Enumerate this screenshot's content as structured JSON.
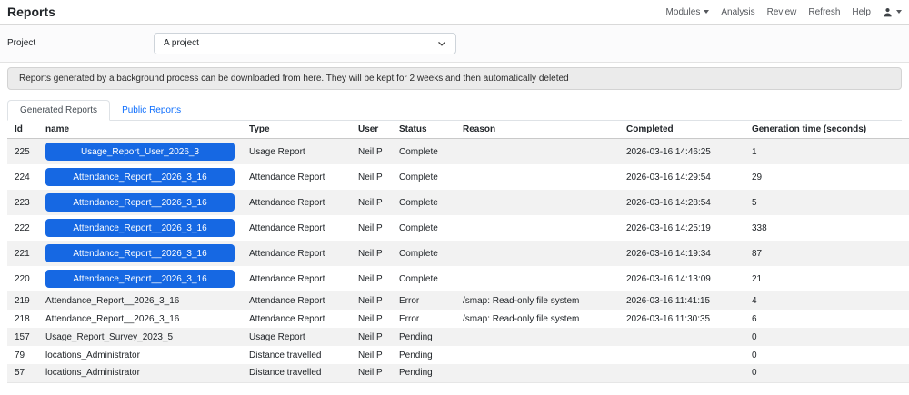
{
  "app": {
    "title": "Reports"
  },
  "nav": {
    "items": [
      {
        "label": "Modules",
        "caret": true
      },
      {
        "label": "Analysis",
        "caret": false
      },
      {
        "label": "Review",
        "caret": false
      },
      {
        "label": "Refresh",
        "caret": false
      },
      {
        "label": "Help",
        "caret": false
      }
    ],
    "user_icon": "person-icon"
  },
  "project": {
    "label": "Project",
    "selected": "A project"
  },
  "alert": {
    "text": "Reports generated by a background process can be downloaded from here. They will be kept for 2 weeks and then automatically deleted"
  },
  "tabs": [
    {
      "label": "Generated Reports",
      "active": true
    },
    {
      "label": "Public Reports",
      "active": false
    }
  ],
  "table": {
    "columns": [
      "Id",
      "name",
      "Type",
      "User",
      "Status",
      "Reason",
      "Completed",
      "Generation time (seconds)"
    ],
    "rows": [
      {
        "id": "225",
        "name": "Usage_Report_User_2026_3",
        "button": true,
        "type": "Usage Report",
        "user": "Neil P",
        "status": "Complete",
        "reason": "",
        "completed": "2026-03-16 14:46:25",
        "gen_time": "1"
      },
      {
        "id": "224",
        "name": "Attendance_Report__2026_3_16",
        "button": true,
        "type": "Attendance Report",
        "user": "Neil P",
        "status": "Complete",
        "reason": "",
        "completed": "2026-03-16 14:29:54",
        "gen_time": "29"
      },
      {
        "id": "223",
        "name": "Attendance_Report__2026_3_16",
        "button": true,
        "type": "Attendance Report",
        "user": "Neil P",
        "status": "Complete",
        "reason": "",
        "completed": "2026-03-16 14:28:54",
        "gen_time": "5"
      },
      {
        "id": "222",
        "name": "Attendance_Report__2026_3_16",
        "button": true,
        "type": "Attendance Report",
        "user": "Neil P",
        "status": "Complete",
        "reason": "",
        "completed": "2026-03-16 14:25:19",
        "gen_time": "338"
      },
      {
        "id": "221",
        "name": "Attendance_Report__2026_3_16",
        "button": true,
        "type": "Attendance Report",
        "user": "Neil P",
        "status": "Complete",
        "reason": "",
        "completed": "2026-03-16 14:19:34",
        "gen_time": "87"
      },
      {
        "id": "220",
        "name": "Attendance_Report__2026_3_16",
        "button": true,
        "type": "Attendance Report",
        "user": "Neil P",
        "status": "Complete",
        "reason": "",
        "completed": "2026-03-16 14:13:09",
        "gen_time": "21"
      },
      {
        "id": "219",
        "name": "Attendance_Report__2026_3_16",
        "button": false,
        "type": "Attendance Report",
        "user": "Neil P",
        "status": "Error",
        "reason": "/smap: Read-only file system",
        "completed": "2026-03-16 11:41:15",
        "gen_time": "4"
      },
      {
        "id": "218",
        "name": "Attendance_Report__2026_3_16",
        "button": false,
        "type": "Attendance Report",
        "user": "Neil P",
        "status": "Error",
        "reason": "/smap: Read-only file system",
        "completed": "2026-03-16 11:30:35",
        "gen_time": "6"
      },
      {
        "id": "157",
        "name": "Usage_Report_Survey_2023_5",
        "button": false,
        "type": "Usage Report",
        "user": "Neil P",
        "status": "Pending",
        "reason": "",
        "completed": "",
        "gen_time": "0"
      },
      {
        "id": "79",
        "name": "locations_Administrator",
        "button": false,
        "type": "Distance travelled",
        "user": "Neil P",
        "status": "Pending",
        "reason": "",
        "completed": "",
        "gen_time": "0"
      },
      {
        "id": "57",
        "name": "locations_Administrator",
        "button": false,
        "type": "Distance travelled",
        "user": "Neil P",
        "status": "Pending",
        "reason": "",
        "completed": "",
        "gen_time": "0"
      }
    ]
  },
  "colors": {
    "primary_button": "#1668e3",
    "link": "#0d6efd",
    "stripe": "#f2f2f2",
    "alert_bg": "#ebebeb"
  }
}
